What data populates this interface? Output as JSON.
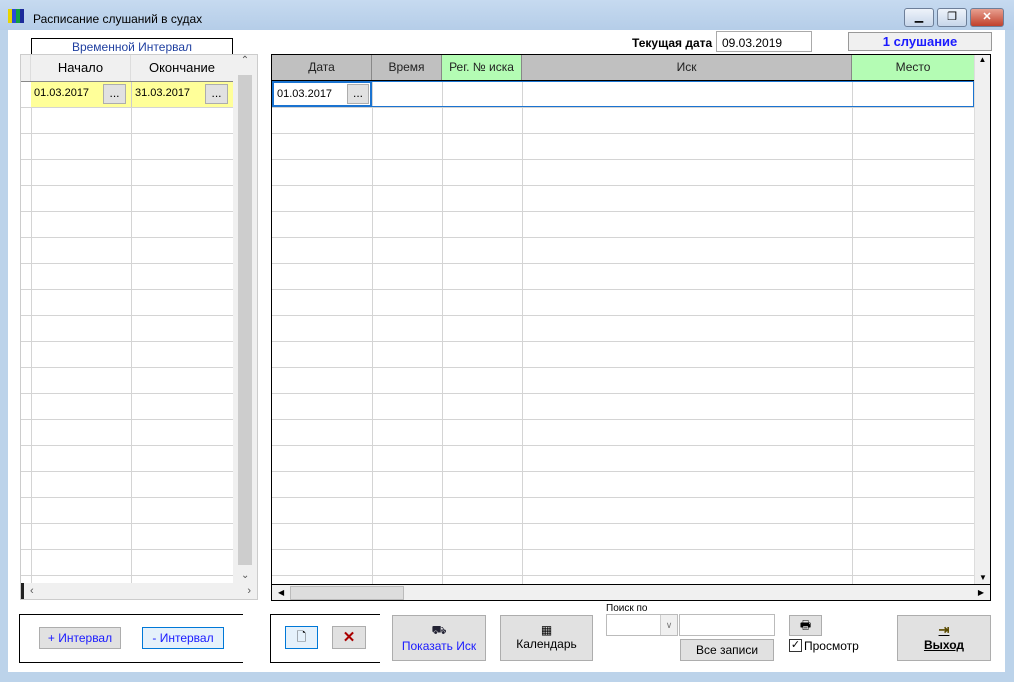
{
  "window": {
    "title": "Расписание слушаний в судах"
  },
  "header": {
    "current_date_label": "Текущая дата",
    "current_date_value": "09.03.2019",
    "count": "1 слушание"
  },
  "interval": {
    "title": "Временной Интервал",
    "columns": [
      "Начало",
      "Окончание"
    ],
    "rows": [
      {
        "start": "01.03.2017",
        "end": "31.03.2017"
      }
    ],
    "ellipsis": "..."
  },
  "grid": {
    "columns": [
      "Дата",
      "Время",
      "Рег. № иска",
      "Иск",
      "Место"
    ],
    "rows": [
      {
        "date": "01.03.2017",
        "time": "",
        "reg": "",
        "claim": "",
        "place": ""
      }
    ],
    "ellipsis": "..."
  },
  "buttons": {
    "add_interval": "+ Интервал",
    "remove_interval": "- Интервал",
    "show_claim": "Показать Иск",
    "calendar": "Календарь",
    "all_records": "Все записи",
    "exit": "Выход"
  },
  "search": {
    "label": "Поиск по",
    "field_value": "",
    "query": ""
  },
  "preview": {
    "label": "Просмотр",
    "checked": true
  },
  "colors": {
    "accent_blue": "#1a1aff",
    "green": "#b4fcb4",
    "yellow": "#ffff99"
  }
}
